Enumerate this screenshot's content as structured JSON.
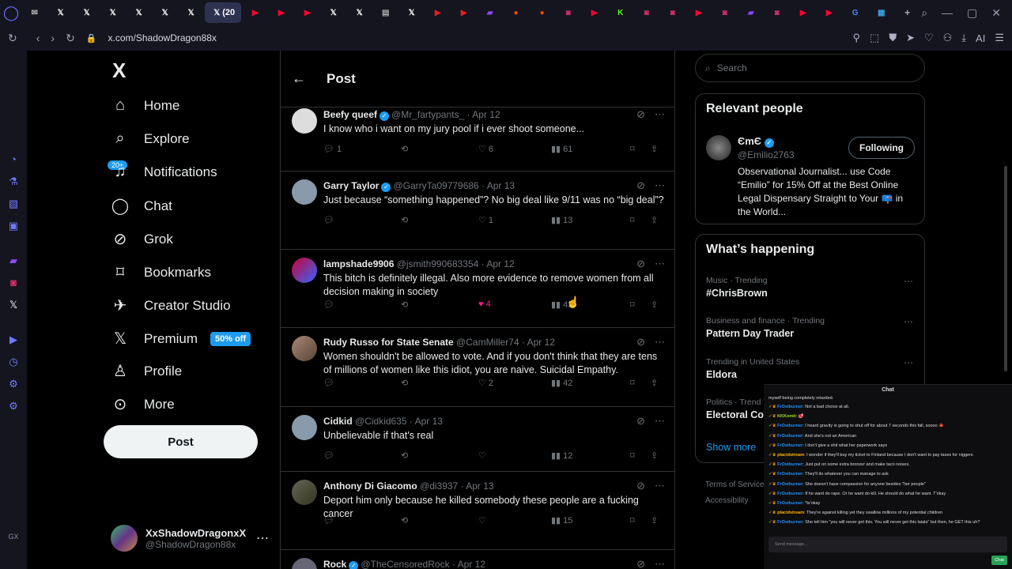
{
  "browser": {
    "active_tab_label": "(20",
    "url": "x.com/ShadowDragon88x",
    "tab_icons": [
      "x",
      "x",
      "x",
      "x",
      "x",
      "x",
      "youtube",
      "youtube",
      "youtube",
      "x",
      "x",
      "news",
      "x",
      "play",
      "play",
      "twitch",
      "reddit",
      "reddit",
      "instagram",
      "youtube",
      "kick",
      "instagram",
      "instagram",
      "youtube",
      "instagram",
      "twitch",
      "instagram",
      "youtube",
      "youtube",
      "google",
      "app"
    ],
    "addr_ai_label": "AI"
  },
  "sidebar": {
    "logo": "X",
    "items": [
      {
        "label": "Home",
        "icon": "home-icon"
      },
      {
        "label": "Explore",
        "icon": "search-icon"
      },
      {
        "label": "Notifications",
        "icon": "bell-icon"
      },
      {
        "label": "Chat",
        "icon": "chat-icon"
      },
      {
        "label": "Grok",
        "icon": "grok-icon"
      },
      {
        "label": "Bookmarks",
        "icon": "bookmark-icon"
      },
      {
        "label": "Creator Studio",
        "icon": "rocket-icon"
      },
      {
        "label": "Premium",
        "icon": "x-icon"
      },
      {
        "label": "Profile",
        "icon": "person-icon"
      },
      {
        "label": "More",
        "icon": "more-icon"
      }
    ],
    "notif_badge": "20+",
    "premium_badge": "50% off",
    "post_button": "Post",
    "account": {
      "name": "XxShadowDragonxX",
      "handle": "@ShadowDragon88x"
    }
  },
  "main": {
    "header_title": "Post",
    "tweets": [
      {
        "name": "Beefy queef",
        "handle": "@Mr_fartypants_",
        "date": "Apr 12",
        "text": "I know who i want on my jury pool if i ever shoot someone...",
        "replies": "1",
        "likes": "6",
        "views": "61",
        "liked": false,
        "verified": true
      },
      {
        "name": "Garry Taylor",
        "handle": "@GarryTa09779686",
        "date": "Apr 13",
        "text": "Just because “something happened”? No big deal like 9/11 was no “big deal”?",
        "replies": "",
        "likes": "1",
        "views": "13",
        "liked": false,
        "verified": true
      },
      {
        "name": "lampshade9906",
        "handle": "@jsmith990683354",
        "date": "Apr 12",
        "text": "This bitch is definitely illegal. Also more evidence to remove women from all decision making in society",
        "replies": "",
        "likes": "4",
        "views": "43",
        "liked": true,
        "verified": false
      },
      {
        "name": "Rudy Russo for State Senate",
        "handle": "@CamMiller74",
        "date": "Apr 12",
        "text": "Women shouldn't be allowed to vote. And if you don't think that they are tens of millions of women like this idiot, you are naive. Suicidal Empathy.",
        "replies": "",
        "likes": "2",
        "views": "42",
        "liked": false,
        "verified": false
      },
      {
        "name": "Cidkid",
        "handle": "@Cidkid635",
        "date": "Apr 13",
        "text": "Unbelievable if that's real",
        "replies": "",
        "likes": "",
        "views": "12",
        "liked": false,
        "verified": false
      },
      {
        "name": "Anthony Di Giacomo",
        "handle": "@di3937",
        "date": "Apr 13",
        "text": "Deport him only because he killed somebody these people are a fucking cancer",
        "replies": "",
        "likes": "",
        "views": "15",
        "liked": false,
        "verified": false
      },
      {
        "name": "Rock",
        "handle": "@TheCensoredRock",
        "date": "Apr 12",
        "text": "",
        "replies": "",
        "likes": "",
        "views": "",
        "liked": false,
        "verified": true
      }
    ]
  },
  "right": {
    "search_placeholder": "Search",
    "relevant_title": "Relevant people",
    "relevant": {
      "name": "ЄmЄ",
      "handle": "@Emilio2763",
      "follow_label": "Following",
      "bio": "Observational Journalist... use Code “Emilio” for 15% Off at the Best Online Legal Dispensary Straight to Your 📪 in the World..."
    },
    "happening_title": "What’s happening",
    "trends": [
      {
        "context": "Music · Trending",
        "name": "#ChrisBrown"
      },
      {
        "context": "Business and finance · Trending",
        "name": "Pattern Day Trader"
      },
      {
        "context": "Trending in United States",
        "name": "Eldora"
      },
      {
        "context": "Politics · Trend",
        "name": "Electoral Co"
      }
    ],
    "show_more": "Show more",
    "footer": [
      "Terms of Service",
      "Accessibility"
    ]
  },
  "chat": {
    "title": "Chat",
    "top_line": "myself being completely retarded.",
    "messages": [
      {
        "user": "FrOstburner",
        "color": "#1e90ff",
        "text": ": Not a bad choice at all."
      },
      {
        "user": "KKKomit",
        "color": "#9cde2c",
        "text": ": 🥩"
      },
      {
        "user": "FrOstburner",
        "color": "#1e90ff",
        "text": ": I heard gravity is going to shut off for about 7 seconds this fall, soooo 🍁"
      },
      {
        "user": "FrOstburner",
        "color": "#1e90ff",
        "text": ": And she's not an American"
      },
      {
        "user": "FrOstburner",
        "color": "#1e90ff",
        "text": ": I don't give a shit what her paperwork says"
      },
      {
        "user": "placidstream",
        "color": "#ffb400",
        "text": ": I wonder if they'll buy my ticket to Finland because I don't want to pay taxes for niggers"
      },
      {
        "user": "FrOstburner",
        "color": "#1e90ff",
        "text": ": Just put on some extra bronzer and make taco noises."
      },
      {
        "user": "FrOstburner",
        "color": "#1e90ff",
        "text": ": They'll do whatever you can manage to ask"
      },
      {
        "user": "FrOstburner",
        "color": "#1e90ff",
        "text": ": She doesn't have compassion for anyone besides \"her people\""
      },
      {
        "user": "FrOstburner",
        "color": "#1e90ff",
        "text": ": If he want do rape. Or he want do kill. He should do what he want. T'okay"
      },
      {
        "user": "FrOstburner",
        "color": "#1e90ff",
        "text": ": *ts'okay"
      },
      {
        "user": "placidstream",
        "color": "#ffb400",
        "text": ": They're against killing yet they swallow millions of my potential children"
      },
      {
        "user": "FrOstburner",
        "color": "#1e90ff",
        "text": ": She tell him \"you will never get this. You will never get this laiala\" but then, he GET this uh?"
      }
    ],
    "input_placeholder": "Send message...",
    "send_label": "Chat"
  }
}
